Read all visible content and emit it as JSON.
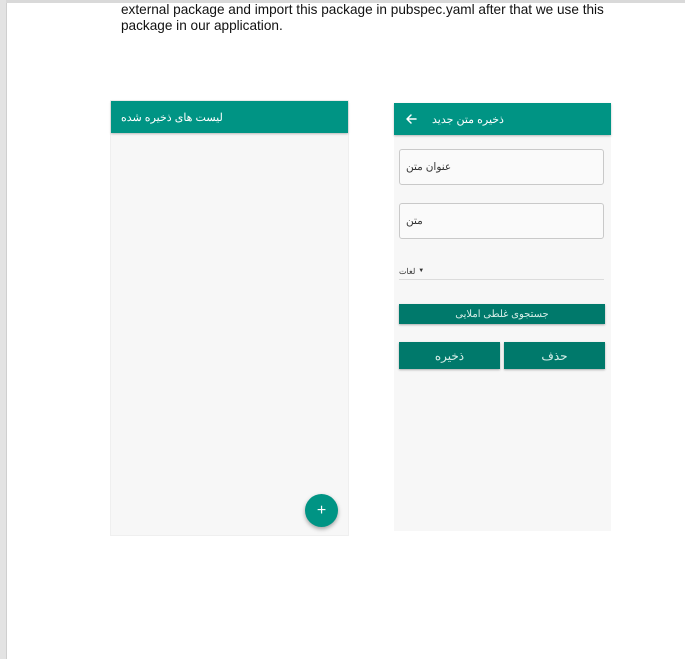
{
  "document": {
    "line1": "external package and import this package in pubspec.yaml after that we use this",
    "line2": "package in our application."
  },
  "list_screen": {
    "title": "لیست های ذخیره شده",
    "fab_label": "+"
  },
  "editor_screen": {
    "title": "ذخیره متن جدید",
    "back_icon": "arrow-left-icon",
    "title_field": "عنوان متن",
    "text_field": "متن",
    "language_dropdown": "لغات",
    "spell_button": "جستجوی غلطی املایی",
    "save_button": "ذخیره",
    "delete_button": "حذف"
  },
  "colors": {
    "appbar": "#009484",
    "button": "#00796b"
  }
}
